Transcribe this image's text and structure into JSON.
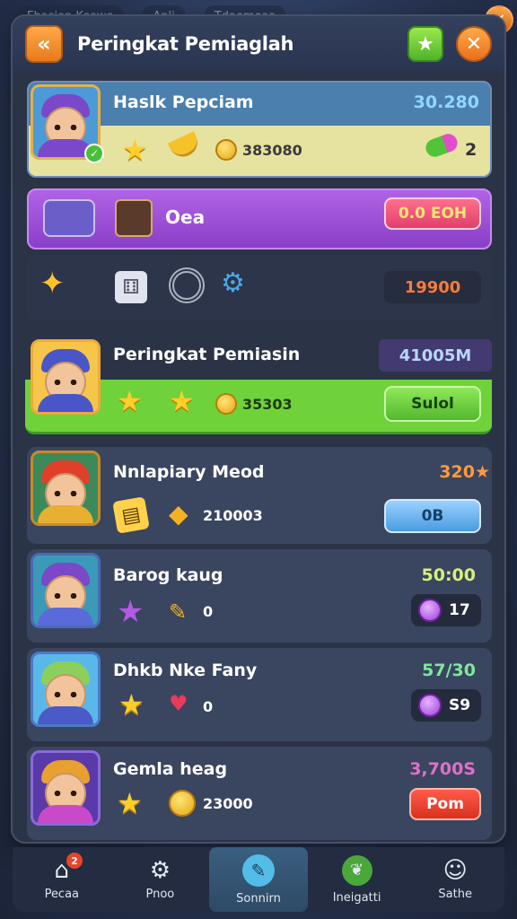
{
  "background_bar": {
    "left_label": "Fbasiop Ksewe",
    "mid_label": "Anli",
    "right_label": "Tdaemeaa"
  },
  "header": {
    "title": "Peringkat Pemiaglah",
    "back_icon": "double-chevron-left",
    "star_icon": "star",
    "close_icon": "x"
  },
  "rows": [
    {
      "rank_type": "self",
      "name": "Haslk Pepciam",
      "score": "30.280",
      "score_color": "#8fd8ff",
      "coins": "383080",
      "extra_count": "2"
    },
    {
      "rank_type": "offer",
      "label": "Oea",
      "button": "0.0 EOH"
    },
    {
      "rank_type": "items",
      "value": "19900"
    },
    {
      "rank_type": "highlight",
      "name": "Peringkat Pemiasin",
      "score": "41005M",
      "coins": "35303",
      "button": "Sulol"
    },
    {
      "name": "Nnlapiary Meod",
      "score": "320★",
      "score_color": "#ff9a3c",
      "stat": "210003",
      "button": "0B"
    },
    {
      "name": "Barog kaug",
      "score": "50:00",
      "score_color": "#d6f07a",
      "stat": "0",
      "gem": "17"
    },
    {
      "name": "Dhkb Nke Fany",
      "score": "57/30",
      "score_color": "#7de89a",
      "stat": "0",
      "gem": "S9"
    },
    {
      "name": "Gemla heag",
      "score": "3,700S",
      "score_color": "#e070c8",
      "stat": "23000",
      "button": "Pom"
    }
  ],
  "nav": [
    {
      "label": "Pecaa",
      "icon": "home",
      "badge": "2"
    },
    {
      "label": "Pnoo",
      "icon": "gear"
    },
    {
      "label": "Sonnirn",
      "icon": "broom",
      "active": true
    },
    {
      "label": "Ineigatti",
      "icon": "leaf"
    },
    {
      "label": "Sathe",
      "icon": "user"
    }
  ],
  "colors": {
    "accent_orange": "#f08a28",
    "green": "#6fcf3a",
    "purple": "#9b4fd8",
    "panel": "#2b3346"
  }
}
